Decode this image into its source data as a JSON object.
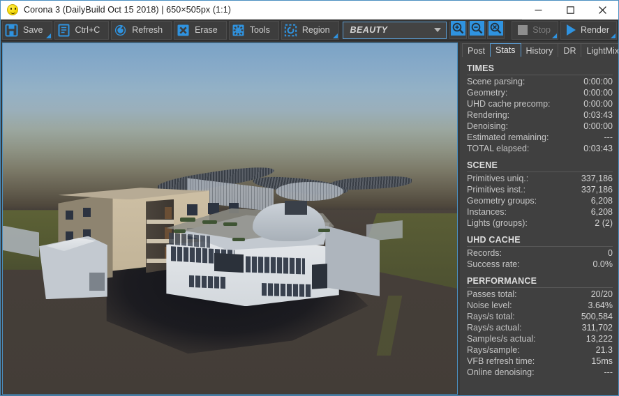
{
  "window": {
    "title": "Corona 3 (DailyBuild Oct 15 2018) | 650×505px (1:1)",
    "icon": "smiley-icon",
    "minimize_label": "minimize-icon",
    "maximize_label": "maximize-icon",
    "close_label": "close-icon"
  },
  "toolbar": {
    "buttons": [
      {
        "label": "Save",
        "icon": "floppy-disk-icon",
        "has_dropdown": true
      },
      {
        "label": "Ctrl+C",
        "icon": "copy-document-icon",
        "has_dropdown": false
      },
      {
        "label": "Refresh",
        "icon": "refresh-icon",
        "has_dropdown": false
      },
      {
        "label": "Erase",
        "icon": "x-cross-icon",
        "has_dropdown": false
      },
      {
        "label": "Tools",
        "icon": "gear-icon",
        "has_dropdown": false
      },
      {
        "label": "Region",
        "icon": "dashed-region-icon",
        "has_dropdown": true
      }
    ],
    "pass_select": {
      "value": "BEAUTY",
      "caret": "chevron-down-icon"
    },
    "zoom_buttons": [
      {
        "name": "zoom-in-icon"
      },
      {
        "name": "zoom-out-icon"
      },
      {
        "name": "zoom-reset-icon"
      }
    ],
    "stop": {
      "label": "Stop",
      "enabled": false,
      "icon": "stop-square-icon"
    },
    "render": {
      "label": "Render",
      "enabled": true,
      "icon": "play-triangle-icon"
    }
  },
  "render_view": {
    "resolution": "650×505px",
    "zoom_ratio": "1:1",
    "scene_description": "Exterior architectural daylight render of a multi-storey school / campus building complex with a white curved modular wing, beige residential block with cutaway stair core, curving steel canopy walkway and asphalt forecourt"
  },
  "panel": {
    "tabs": [
      {
        "label": "Post",
        "active": false
      },
      {
        "label": "Stats",
        "active": true
      },
      {
        "label": "History",
        "active": false
      },
      {
        "label": "DR",
        "active": false
      },
      {
        "label": "LightMix",
        "active": false
      }
    ],
    "sections": [
      {
        "title": "TIMES",
        "rows": [
          {
            "key": "Scene parsing:",
            "value": "0:00:00"
          },
          {
            "key": "Geometry:",
            "value": "0:00:00"
          },
          {
            "key": "UHD cache precomp:",
            "value": "0:00:00"
          },
          {
            "key": "Rendering:",
            "value": "0:03:43"
          },
          {
            "key": "Denoising:",
            "value": "0:00:00"
          },
          {
            "key": "Estimated remaining:",
            "value": "---"
          },
          {
            "key": "TOTAL elapsed:",
            "value": "0:03:43"
          }
        ]
      },
      {
        "title": "SCENE",
        "rows": [
          {
            "key": "Primitives uniq.:",
            "value": "337,186"
          },
          {
            "key": "Primitives inst.:",
            "value": "337,186"
          },
          {
            "key": "Geometry groups:",
            "value": "6,208"
          },
          {
            "key": "Instances:",
            "value": "6,208"
          },
          {
            "key": "Lights (groups):",
            "value": "2 (2)"
          }
        ]
      },
      {
        "title": "UHD CACHE",
        "rows": [
          {
            "key": "Records:",
            "value": "0"
          },
          {
            "key": "Success rate:",
            "value": "0.0%"
          }
        ]
      },
      {
        "title": "PERFORMANCE",
        "rows": [
          {
            "key": "Passes total:",
            "value": "20/20"
          },
          {
            "key": "Noise level:",
            "value": "3.64%"
          },
          {
            "key": "Rays/s total:",
            "value": "500,584"
          },
          {
            "key": "Rays/s actual:",
            "value": "311,702"
          },
          {
            "key": "Samples/s actual:",
            "value": "13,222"
          },
          {
            "key": "Rays/sample:",
            "value": "21.3"
          },
          {
            "key": "VFB refresh time:",
            "value": "15ms"
          },
          {
            "key": "Online denoising:",
            "value": "---"
          }
        ]
      }
    ]
  },
  "colors": {
    "accent": "#2f93e0",
    "panel_bg": "#404040",
    "toolbar_bg": "#353535",
    "titlebar_bg": "#ffffff",
    "border": "#4a8fc0"
  }
}
